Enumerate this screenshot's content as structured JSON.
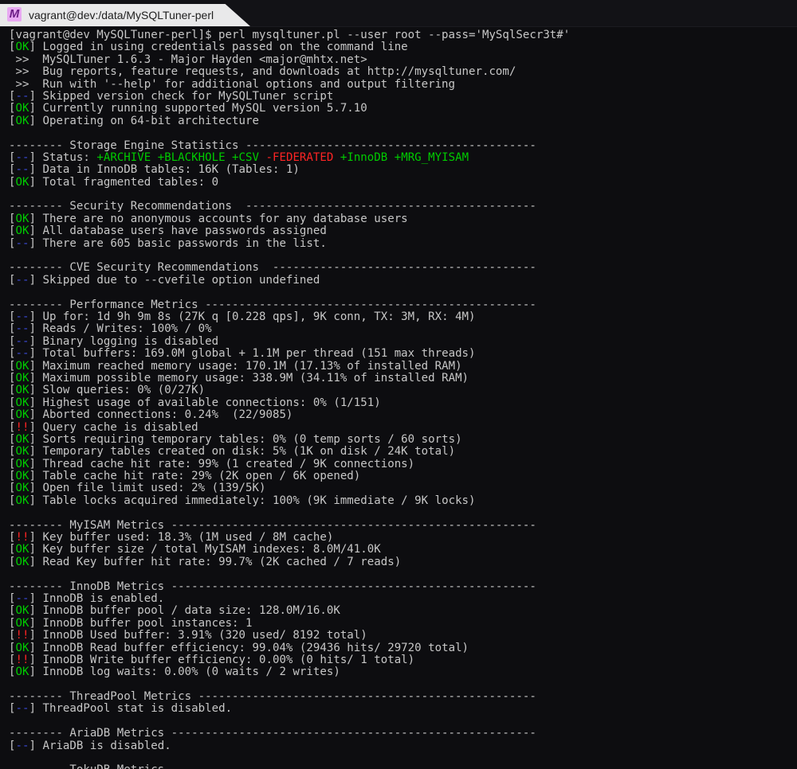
{
  "window": {
    "title": "vagrant@dev:/data/MySQLTuner-perl",
    "app_icon": "mintty-icon"
  },
  "colors": {
    "background": "#0d0d10",
    "text": "#c7c7c7",
    "ok": "#00cc00",
    "info": "#3a4ad8",
    "bad": "#ff2424"
  },
  "terminal": {
    "lines": [
      {
        "text": "[vagrant@dev MySQLTuner-perl]$ perl mysqltuner.pl --user root --pass='MySqlSecr3t#'"
      },
      {
        "tag": "OK",
        "text": " Logged in using credentials passed on the command line"
      },
      {
        "text": " >>  MySQLTuner 1.6.3 - Major Hayden <major@mhtx.net>"
      },
      {
        "text": " >>  Bug reports, feature requests, and downloads at http://mysqltuner.com/"
      },
      {
        "text": " >>  Run with '--help' for additional options and output filtering"
      },
      {
        "tag": "--",
        "text": " Skipped version check for MySQLTuner script"
      },
      {
        "tag": "OK",
        "text": " Currently running supported MySQL version 5.7.10"
      },
      {
        "tag": "OK",
        "text": " Operating on 64-bit architecture"
      },
      {
        "text": ""
      },
      {
        "text": "-------- Storage Engine Statistics -------------------------------------------"
      },
      {
        "tag": "--",
        "text": " Status: ",
        "parts": [
          {
            "text": "+ARCHIVE +BLACKHOLE +CSV ",
            "color": "grn"
          },
          {
            "text": "-FEDERATED ",
            "color": "red"
          },
          {
            "text": "+InnoDB +MRG_MYISAM",
            "color": "grn"
          }
        ]
      },
      {
        "tag": "--",
        "text": " Data in InnoDB tables: 16K (Tables: 1)"
      },
      {
        "tag": "OK",
        "text": " Total fragmented tables: 0"
      },
      {
        "text": ""
      },
      {
        "text": "-------- Security Recommendations  -------------------------------------------"
      },
      {
        "tag": "OK",
        "text": " There are no anonymous accounts for any database users"
      },
      {
        "tag": "OK",
        "text": " All database users have passwords assigned"
      },
      {
        "tag": "--",
        "text": " There are 605 basic passwords in the list."
      },
      {
        "text": ""
      },
      {
        "text": "-------- CVE Security Recommendations  ---------------------------------------"
      },
      {
        "tag": "--",
        "text": " Skipped due to --cvefile option undefined"
      },
      {
        "text": ""
      },
      {
        "text": "-------- Performance Metrics -------------------------------------------------"
      },
      {
        "tag": "--",
        "text": " Up for: 1d 9h 9m 8s (27K q [0.228 qps], 9K conn, TX: 3M, RX: 4M)"
      },
      {
        "tag": "--",
        "text": " Reads / Writes: 100% / 0%"
      },
      {
        "tag": "--",
        "text": " Binary logging is disabled"
      },
      {
        "tag": "--",
        "text": " Total buffers: 169.0M global + 1.1M per thread (151 max threads)"
      },
      {
        "tag": "OK",
        "text": " Maximum reached memory usage: 170.1M (17.13% of installed RAM)"
      },
      {
        "tag": "OK",
        "text": " Maximum possible memory usage: 338.9M (34.11% of installed RAM)"
      },
      {
        "tag": "OK",
        "text": " Slow queries: 0% (0/27K)"
      },
      {
        "tag": "OK",
        "text": " Highest usage of available connections: 0% (1/151)"
      },
      {
        "tag": "OK",
        "text": " Aborted connections: 0.24%  (22/9085)"
      },
      {
        "tag": "!!",
        "text": " Query cache is disabled"
      },
      {
        "tag": "OK",
        "text": " Sorts requiring temporary tables: 0% (0 temp sorts / 60 sorts)"
      },
      {
        "tag": "OK",
        "text": " Temporary tables created on disk: 5% (1K on disk / 24K total)"
      },
      {
        "tag": "OK",
        "text": " Thread cache hit rate: 99% (1 created / 9K connections)"
      },
      {
        "tag": "OK",
        "text": " Table cache hit rate: 29% (2K open / 6K opened)"
      },
      {
        "tag": "OK",
        "text": " Open file limit used: 2% (139/5K)"
      },
      {
        "tag": "OK",
        "text": " Table locks acquired immediately: 100% (9K immediate / 9K locks)"
      },
      {
        "text": ""
      },
      {
        "text": "-------- MyISAM Metrics ------------------------------------------------------"
      },
      {
        "tag": "!!",
        "text": " Key buffer used: 18.3% (1M used / 8M cache)"
      },
      {
        "tag": "OK",
        "text": " Key buffer size / total MyISAM indexes: 8.0M/41.0K"
      },
      {
        "tag": "OK",
        "text": " Read Key buffer hit rate: 99.7% (2K cached / 7 reads)"
      },
      {
        "text": ""
      },
      {
        "text": "-------- InnoDB Metrics ------------------------------------------------------"
      },
      {
        "tag": "--",
        "text": " InnoDB is enabled."
      },
      {
        "tag": "OK",
        "text": " InnoDB buffer pool / data size: 128.0M/16.0K"
      },
      {
        "tag": "OK",
        "text": " InnoDB buffer pool instances: 1"
      },
      {
        "tag": "!!",
        "text": " InnoDB Used buffer: 3.91% (320 used/ 8192 total)"
      },
      {
        "tag": "OK",
        "text": " InnoDB Read buffer efficiency: 99.04% (29436 hits/ 29720 total)"
      },
      {
        "tag": "!!",
        "text": " InnoDB Write buffer efficiency: 0.00% (0 hits/ 1 total)"
      },
      {
        "tag": "OK",
        "text": " InnoDB log waits: 0.00% (0 waits / 2 writes)"
      },
      {
        "text": ""
      },
      {
        "text": "-------- ThreadPool Metrics --------------------------------------------------"
      },
      {
        "tag": "--",
        "text": " ThreadPool stat is disabled."
      },
      {
        "text": ""
      },
      {
        "text": "-------- AriaDB Metrics ------------------------------------------------------"
      },
      {
        "tag": "--",
        "text": " AriaDB is disabled."
      },
      {
        "text": ""
      },
      {
        "text": "-------- TokuDB Metrics ------------------------------------------------------"
      }
    ]
  }
}
